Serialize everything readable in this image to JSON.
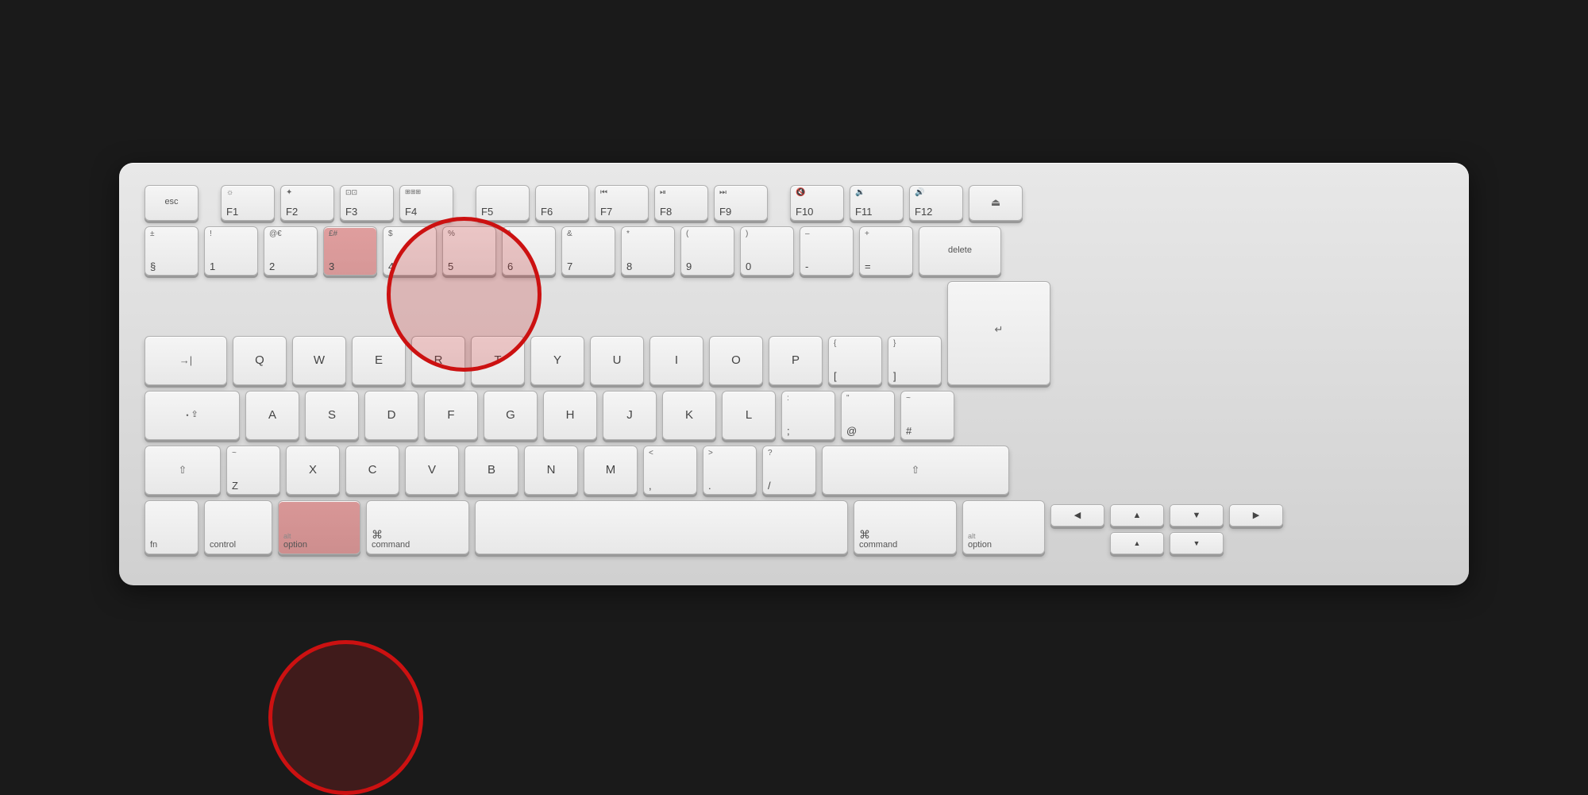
{
  "keyboard": {
    "background": "#d4d4d4",
    "rows": {
      "fn_row": [
        "esc",
        "F1",
        "F2",
        "F3",
        "F4",
        "F5",
        "F6",
        "F7",
        "F8",
        "F9",
        "F10",
        "F11",
        "F12",
        "eject"
      ],
      "num_row": [
        "§/±",
        "1/!",
        "2/@€",
        "3/£#",
        "4/$",
        "5/%",
        "6/^",
        "7/&",
        "8/*",
        "9/(",
        "0/)",
        "-/–",
        "=/+",
        "delete"
      ],
      "qwerty": [
        "tab",
        "Q",
        "W",
        "E",
        "R",
        "T",
        "Y",
        "U",
        "I",
        "O",
        "P",
        "[/{",
        "]/}",
        "return"
      ],
      "asdf": [
        "caps",
        "A",
        "S",
        "D",
        "F",
        "G",
        "H",
        "J",
        "K",
        "L",
        ":/;",
        "@/\"",
        "#/~",
        "return2"
      ],
      "zxcv": [
        "shift",
        "Z",
        "X",
        "C",
        "V",
        "B",
        "N",
        "M",
        "</,",
        ">/.",
        "//?",
        "shift_r"
      ],
      "bottom": [
        "fn",
        "control",
        "option",
        "command",
        "space",
        "command_r",
        "option_r",
        "arrows"
      ]
    },
    "highlights": {
      "top": {
        "label": "3 key with £# highlighted",
        "circle_top": true
      },
      "bottom": {
        "label": "option/alt key highlighted",
        "circle_bottom": true
      }
    }
  },
  "labels": {
    "esc": "esc",
    "f1": "F1",
    "f2": "F2",
    "f3": "F3",
    "f4": "F4",
    "f5": "F5",
    "f6": "F6",
    "f7": "F7",
    "f8": "F8",
    "f9": "F9",
    "f10": "F10",
    "f11": "F11",
    "f12": "F12",
    "tab": "→|",
    "caps_label": "⇪",
    "shift_label": "⇧",
    "fn_label": "fn",
    "control_label": "control",
    "option_label": "option",
    "alt_label": "alt",
    "command_label": "command",
    "command_symbol": "⌘",
    "alt_symbol": "⌥",
    "left_arrow": "◀",
    "right_arrow": "▶",
    "up_arrow": "▲",
    "down_arrow": "▼",
    "return_label": "↵",
    "delete_label": "delete",
    "eject_label": "⏏"
  }
}
